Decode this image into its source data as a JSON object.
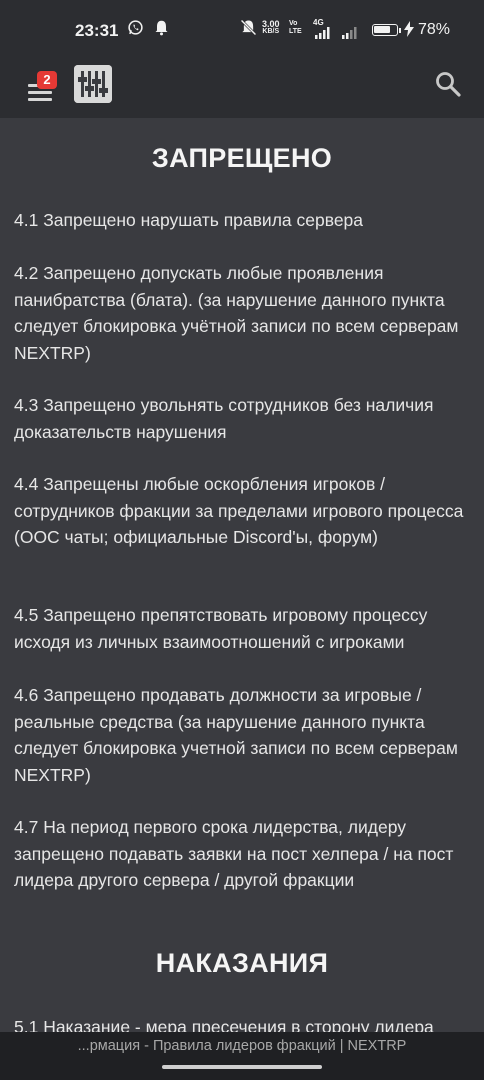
{
  "status_bar": {
    "time": "23:31",
    "net_speed_value": "3.00",
    "net_speed_unit": "KB/S",
    "volte_top": "Vo",
    "volte_bottom": "LTE",
    "lte_label": "4G",
    "battery_percent_text": "78%",
    "battery_level": 0.78,
    "icons": [
      "whatsapp-icon",
      "notification-bell-icon",
      "mute-icon",
      "signal-icon",
      "wifi-icon",
      "battery-icon",
      "charging-icon"
    ]
  },
  "app_bar": {
    "notification_count": "2",
    "icons": [
      "menu-icon",
      "logo-icon",
      "search-icon"
    ]
  },
  "content": {
    "section1_title": "ЗАПРЕЩЕНО",
    "rules": [
      "4.1 Запрещено нарушать правила сервера",
      "4.2 Запрещено допускать любые проявления панибратства (блата). (за нарушение данного пункта следует блокировка учётной записи по всем серверам NEXTRP)",
      "4.3 Запрещено увольнять сотрудников без наличия доказательств нарушения",
      "4.4 Запрещены любые оскорбления игроков / сотрудников фракции за пределами игрового процесса (ООС чаты; официальные Discord'ы, форум)",
      "4.5 Запрещено препятствовать игровому процессу исходя из личных взаимоотношений с игроками",
      "4.6 Запрещено продавать должности за игровые / реальные средства (за нарушение данного пункта следует блокировка учетной записи по всем серверам NEXTRP)",
      "4.7 На период первого срока лидерства, лидеру запрещено подавать заявки на пост хелпера / на пост лидера другого сервера / другой фракции"
    ],
    "section2_title": "НАКАЗАНИЯ",
    "next_rule": "5.1 Наказание - мера пресечения в сторону лидера"
  },
  "caption": {
    "text": "...рмация - Правила лидеров фракций | NEXTRP"
  }
}
